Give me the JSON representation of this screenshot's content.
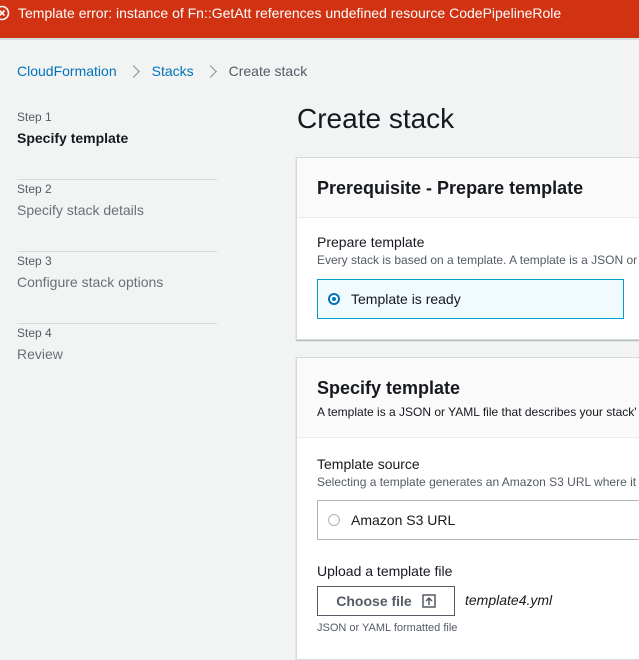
{
  "error_banner": {
    "message": "Template error: instance of Fn::GetAtt references undefined resource CodePipelineRole"
  },
  "breadcrumb": {
    "items": [
      "CloudFormation",
      "Stacks"
    ],
    "current": "Create stack"
  },
  "steps": [
    {
      "number": "Step 1",
      "title": "Specify template",
      "active": true
    },
    {
      "number": "Step 2",
      "title": "Specify stack details",
      "active": false
    },
    {
      "number": "Step 3",
      "title": "Configure stack options",
      "active": false
    },
    {
      "number": "Step 4",
      "title": "Review",
      "active": false
    }
  ],
  "page_title": "Create stack",
  "prerequisite": {
    "title": "Prerequisite - Prepare template",
    "field_label": "Prepare template",
    "field_desc": "Every stack is based on a template. A template is a JSON or",
    "selected_option": "Template is ready"
  },
  "specify_template": {
    "title": "Specify template",
    "desc": "A template is a JSON or YAML file that describes your stack'",
    "source_label": "Template source",
    "source_desc": "Selecting a template generates an Amazon S3 URL where it",
    "source_option": "Amazon S3 URL",
    "upload_label": "Upload a template file",
    "choose_file_label": "Choose file",
    "file_name": "template4.yml",
    "constraint": "JSON or YAML formatted file"
  },
  "colors": {
    "error": "#d13212",
    "link": "#0073bb",
    "selected_border": "#00a1c9"
  }
}
